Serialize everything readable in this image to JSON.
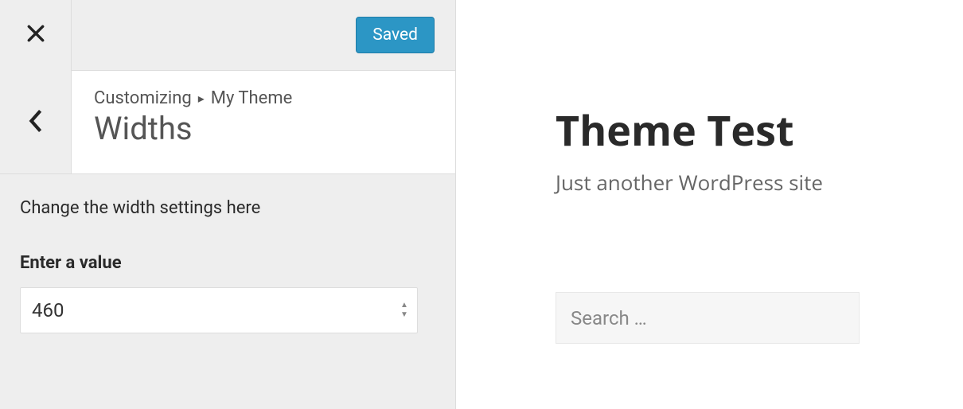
{
  "topbar": {
    "saved_label": "Saved"
  },
  "breadcrumb": {
    "prefix": "Customizing",
    "parent": "My Theme",
    "title": "Widths"
  },
  "panel": {
    "description": "Change the width settings here",
    "field_label": "Enter a value",
    "field_value": "460"
  },
  "preview": {
    "site_title": "Theme Test",
    "site_tagline": "Just another WordPress site",
    "search_placeholder": "Search …"
  }
}
